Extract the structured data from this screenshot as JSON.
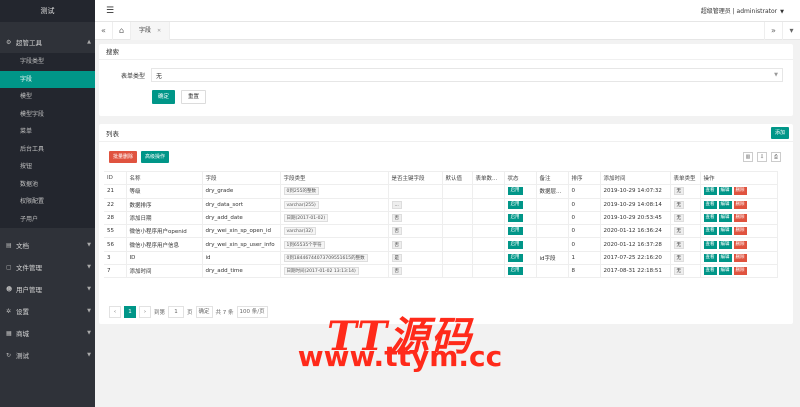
{
  "brand": "测试",
  "user": "超级管理员 | administrator",
  "colors": {
    "accent": "#009688",
    "danger": "#e0533f",
    "sidebar": "#2f3239"
  },
  "sidebar": {
    "groups": [
      {
        "label": "超管工具",
        "icon": "gear-icon",
        "expanded": true,
        "items": [
          "字段类型",
          "字段",
          "模型",
          "模型字段",
          "菜单",
          "后台工具",
          "按钮",
          "数据池",
          "权限配置",
          "子用户"
        ]
      },
      {
        "label": "文档",
        "icon": "document-icon"
      },
      {
        "label": "文件管理",
        "icon": "folder-icon"
      },
      {
        "label": "用户管理",
        "icon": "users-icon"
      },
      {
        "label": "设置",
        "icon": "settings-icon"
      },
      {
        "label": "商城",
        "icon": "shop-icon"
      },
      {
        "label": "测试",
        "icon": "refresh-icon"
      }
    ],
    "active_item": "字段"
  },
  "tabs": {
    "active": "字段"
  },
  "search": {
    "title": "搜索",
    "label": "表单类型",
    "value": "无",
    "confirm": "确定",
    "reset": "重置"
  },
  "list": {
    "title": "列表",
    "add": "添加",
    "batch_delete": "批量删除",
    "advanced": "高级操作",
    "columns": [
      "ID",
      "名称",
      "字段",
      "字段类型",
      "是否主键字段",
      "默认值",
      "表单数...",
      "状态",
      "备注",
      "排序",
      "添加时间",
      "表单类型",
      "操作"
    ],
    "rows": [
      {
        "id": "21",
        "name": "等级",
        "field": "dry_grade",
        "type": "0到255的整数",
        "pk": "",
        "default": "",
        "form": "",
        "status": "启用",
        "remark": "数据层...",
        "sort": "0",
        "time": "2019-10-29 14:07:32",
        "ftype": "无"
      },
      {
        "id": "22",
        "name": "数据排序",
        "field": "dry_data_sort",
        "type": "varchar(255)",
        "pk": "...",
        "default": "",
        "form": "",
        "status": "启用",
        "remark": "",
        "sort": "0",
        "time": "2019-10-29 14:08:14",
        "ftype": "无"
      },
      {
        "id": "28",
        "name": "添加日期",
        "field": "dry_add_date",
        "type": "日期(2017-01-02)",
        "pk": "否",
        "default": "",
        "form": "",
        "status": "启用",
        "remark": "",
        "sort": "0",
        "time": "2019-10-29 20:53:45",
        "ftype": "无"
      },
      {
        "id": "55",
        "name": "微信小程序用户openid",
        "field": "dry_wei_xin_sp_open_id",
        "type": "varchar(32)",
        "pk": "否",
        "default": "",
        "form": "",
        "status": "启用",
        "remark": "",
        "sort": "0",
        "time": "2020-01-12 16:36:24",
        "ftype": "无"
      },
      {
        "id": "56",
        "name": "微信小程序用户信息",
        "field": "dry_wei_xin_sp_user_info",
        "type": "1到65535个字符",
        "pk": "否",
        "default": "",
        "form": "",
        "status": "启用",
        "remark": "",
        "sort": "0",
        "time": "2020-01-12 16:37:28",
        "ftype": "无"
      },
      {
        "id": "3",
        "name": "ID",
        "field": "id",
        "type": "0到18446744073709551615的整数",
        "pk": "是",
        "default": "",
        "form": "",
        "status": "启用",
        "remark": "id字段",
        "sort": "1",
        "time": "2017-07-25 22:16:20",
        "ftype": "无"
      },
      {
        "id": "7",
        "name": "添加时间",
        "field": "dry_add_time",
        "type": "日期时间(2017-01-02 13:13:14)",
        "pk": "否",
        "default": "",
        "form": "",
        "status": "启用",
        "remark": "",
        "sort": "8",
        "time": "2017-08-31 22:18:51",
        "ftype": "无"
      }
    ],
    "actions": {
      "view": "查看",
      "edit": "编辑",
      "delete": "删除"
    }
  },
  "pager": {
    "current": "1",
    "goto_label": "到第",
    "goto_value": "1",
    "page_unit": "页",
    "confirm": "确定",
    "total": "共 7 条",
    "page_size": "100 条/页"
  },
  "watermark": {
    "logo": "TT源码",
    "url": "www.ttym.cc"
  }
}
